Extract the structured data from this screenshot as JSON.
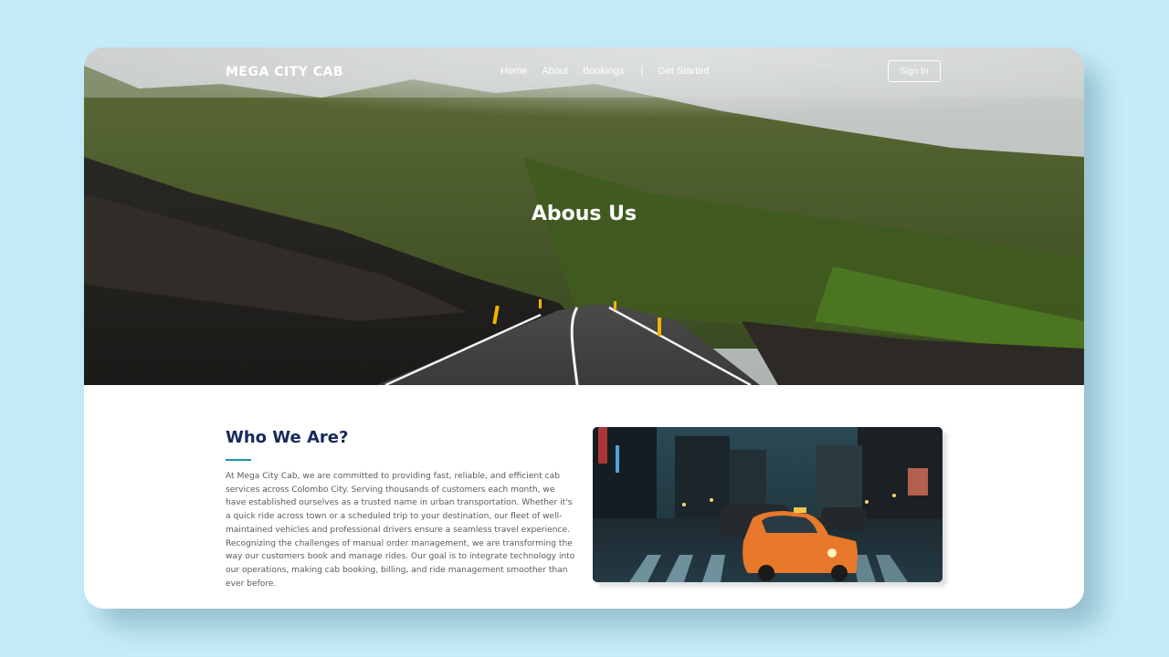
{
  "brand": {
    "name": "MEGA CITY CAB"
  },
  "nav": {
    "items": [
      {
        "label": "Home"
      },
      {
        "label": "About"
      },
      {
        "label": "Bookings"
      },
      {
        "label": "Get Started"
      }
    ],
    "separator": "|",
    "signin_label": "Sign In"
  },
  "hero": {
    "title": "Abous Us"
  },
  "about": {
    "title": "Who We Are?",
    "body": "At Mega City Cab, we are committed to providing fast, reliable, and efficient cab services across Colombo City. Serving thousands of customers each month, we have established ourselves as a trusted name in urban transportation. Whether it's a quick ride across town or a scheduled trip to your destination, our fleet of well-maintained vehicles and professional drivers ensure a seamless travel experience. Recognizing the challenges of manual order management, we are transforming the way our customers book and manage rides. Our goal is to integrate technology into our operations, making cab booking, billing, and ride management smoother than ever before."
  },
  "colors": {
    "background": "#c5ecf8",
    "heading": "#17295a",
    "accent_underline": "#1f8fb0",
    "body_text": "#555a60"
  }
}
